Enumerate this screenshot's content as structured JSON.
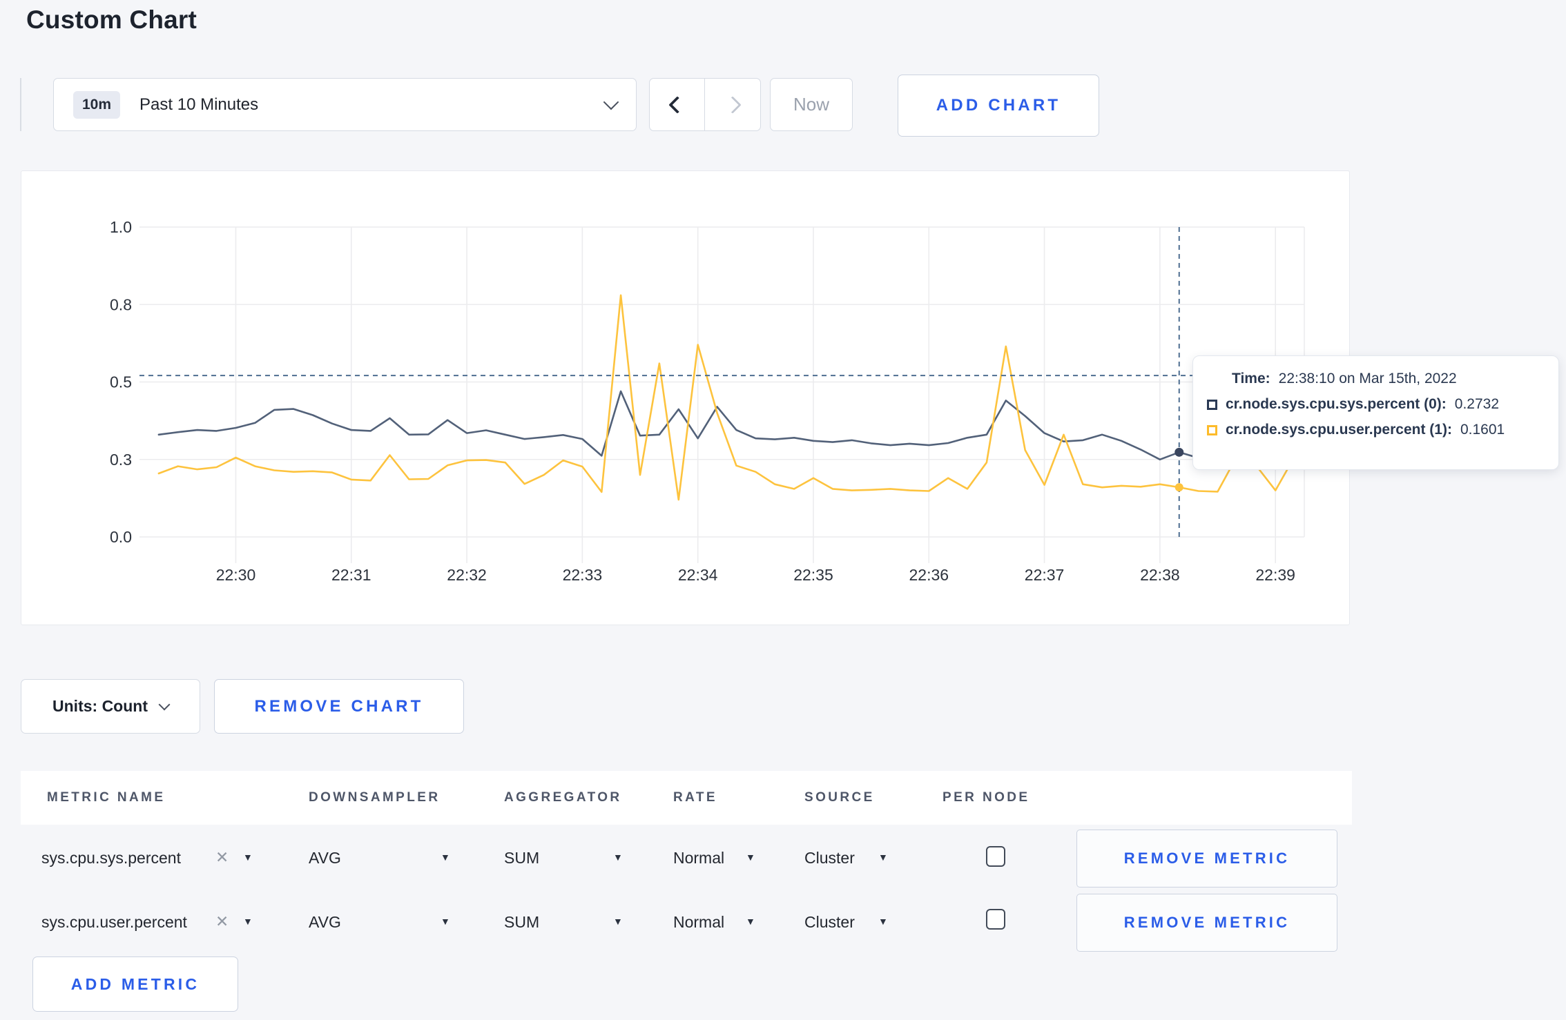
{
  "page": {
    "title": "Custom Chart"
  },
  "toolbar": {
    "time_range": {
      "badge": "10m",
      "label": "Past 10 Minutes"
    },
    "now_label": "Now",
    "add_chart_label": "ADD CHART"
  },
  "chart_footer": {
    "units_label": "Units: Count",
    "remove_chart_label": "REMOVE CHART"
  },
  "tooltip": {
    "time_label": "Time:",
    "time_value": "22:38:10 on Mar 15th, 2022",
    "rows": [
      {
        "label": "cr.node.sys.cpu.sys.percent (0):",
        "value": "0.2732",
        "swatch_color": "#2b3a55"
      },
      {
        "label": "cr.node.sys.cpu.user.percent (1):",
        "value": "0.1601",
        "swatch_color": "#fdbb2a"
      }
    ]
  },
  "chart_data": {
    "type": "line",
    "title": "",
    "xlabel": "",
    "ylabel": "",
    "ylim": [
      0,
      1
    ],
    "grid": true,
    "legend_position": "tooltip-only",
    "y_ticks": [
      {
        "value": 0.0,
        "label": "0.0"
      },
      {
        "value": 0.25,
        "label": "0.3"
      },
      {
        "value": 0.5,
        "label": "0.5"
      },
      {
        "value": 0.75,
        "label": "0.8"
      },
      {
        "value": 1.0,
        "label": "1.0"
      }
    ],
    "x_domain_seconds": [
      0,
      600
    ],
    "x_ticks": [
      {
        "seconds": 45,
        "label": "22:30"
      },
      {
        "seconds": 105,
        "label": "22:31"
      },
      {
        "seconds": 165,
        "label": "22:32"
      },
      {
        "seconds": 225,
        "label": "22:33"
      },
      {
        "seconds": 285,
        "label": "22:34"
      },
      {
        "seconds": 345,
        "label": "22:35"
      },
      {
        "seconds": 405,
        "label": "22:36"
      },
      {
        "seconds": 465,
        "label": "22:37"
      },
      {
        "seconds": 525,
        "label": "22:38"
      },
      {
        "seconds": 585,
        "label": "22:39"
      }
    ],
    "first_sample_offset_seconds": 5,
    "sample_interval_seconds": 10,
    "series": [
      {
        "name": "cr.node.sys.cpu.sys.percent (0)",
        "color": "#526179",
        "dot_color": "#39455e",
        "values": [
          0.33,
          0.338,
          0.345,
          0.342,
          0.352,
          0.368,
          0.41,
          0.413,
          0.393,
          0.366,
          0.345,
          0.342,
          0.383,
          0.33,
          0.331,
          0.377,
          0.335,
          0.344,
          0.33,
          0.316,
          0.322,
          0.329,
          0.316,
          0.262,
          0.47,
          0.327,
          0.33,
          0.412,
          0.318,
          0.42,
          0.345,
          0.318,
          0.315,
          0.32,
          0.31,
          0.306,
          0.312,
          0.302,
          0.296,
          0.301,
          0.296,
          0.303,
          0.32,
          0.33,
          0.44,
          0.39,
          0.335,
          0.308,
          0.312,
          0.33,
          0.31,
          0.282,
          0.25,
          0.2732,
          0.255,
          0.262,
          0.27,
          0.266,
          0.272,
          0.27
        ]
      },
      {
        "name": "cr.node.sys.cpu.user.percent (1)",
        "color": "#fdc33e",
        "dot_color": "#fdc33e",
        "values": [
          0.205,
          0.228,
          0.218,
          0.225,
          0.256,
          0.228,
          0.215,
          0.21,
          0.212,
          0.208,
          0.185,
          0.182,
          0.264,
          0.186,
          0.187,
          0.231,
          0.247,
          0.248,
          0.24,
          0.171,
          0.2,
          0.247,
          0.227,
          0.145,
          0.78,
          0.2,
          0.56,
          0.12,
          0.62,
          0.4,
          0.23,
          0.21,
          0.17,
          0.155,
          0.19,
          0.155,
          0.15,
          0.152,
          0.155,
          0.15,
          0.148,
          0.19,
          0.155,
          0.24,
          0.615,
          0.28,
          0.168,
          0.33,
          0.17,
          0.16,
          0.165,
          0.162,
          0.17,
          0.1601,
          0.148,
          0.146,
          0.26,
          0.23,
          0.15,
          0.26
        ]
      }
    ],
    "crosshair": {
      "time_offset_seconds": 535,
      "h_line_value": 0.521,
      "point_values": [
        0.2732,
        0.1601
      ]
    }
  },
  "table": {
    "columns": [
      "METRIC NAME",
      "DOWNSAMPLER",
      "AGGREGATOR",
      "RATE",
      "SOURCE",
      "PER NODE"
    ],
    "rows": [
      {
        "metric": "sys.cpu.sys.percent",
        "downsampler": "AVG",
        "aggregator": "SUM",
        "rate": "Normal",
        "source": "Cluster",
        "per_node_checked": false,
        "remove_label": "REMOVE METRIC"
      },
      {
        "metric": "sys.cpu.user.percent",
        "downsampler": "AVG",
        "aggregator": "SUM",
        "rate": "Normal",
        "source": "Cluster",
        "per_node_checked": false,
        "remove_label": "REMOVE METRIC"
      }
    ],
    "add_metric_label": "ADD METRIC"
  },
  "colors": {
    "accent_blue": "#2b5de8",
    "crosshair": "#4e6e91",
    "gridline": "#ececee",
    "axis_text": "#2c323c"
  }
}
